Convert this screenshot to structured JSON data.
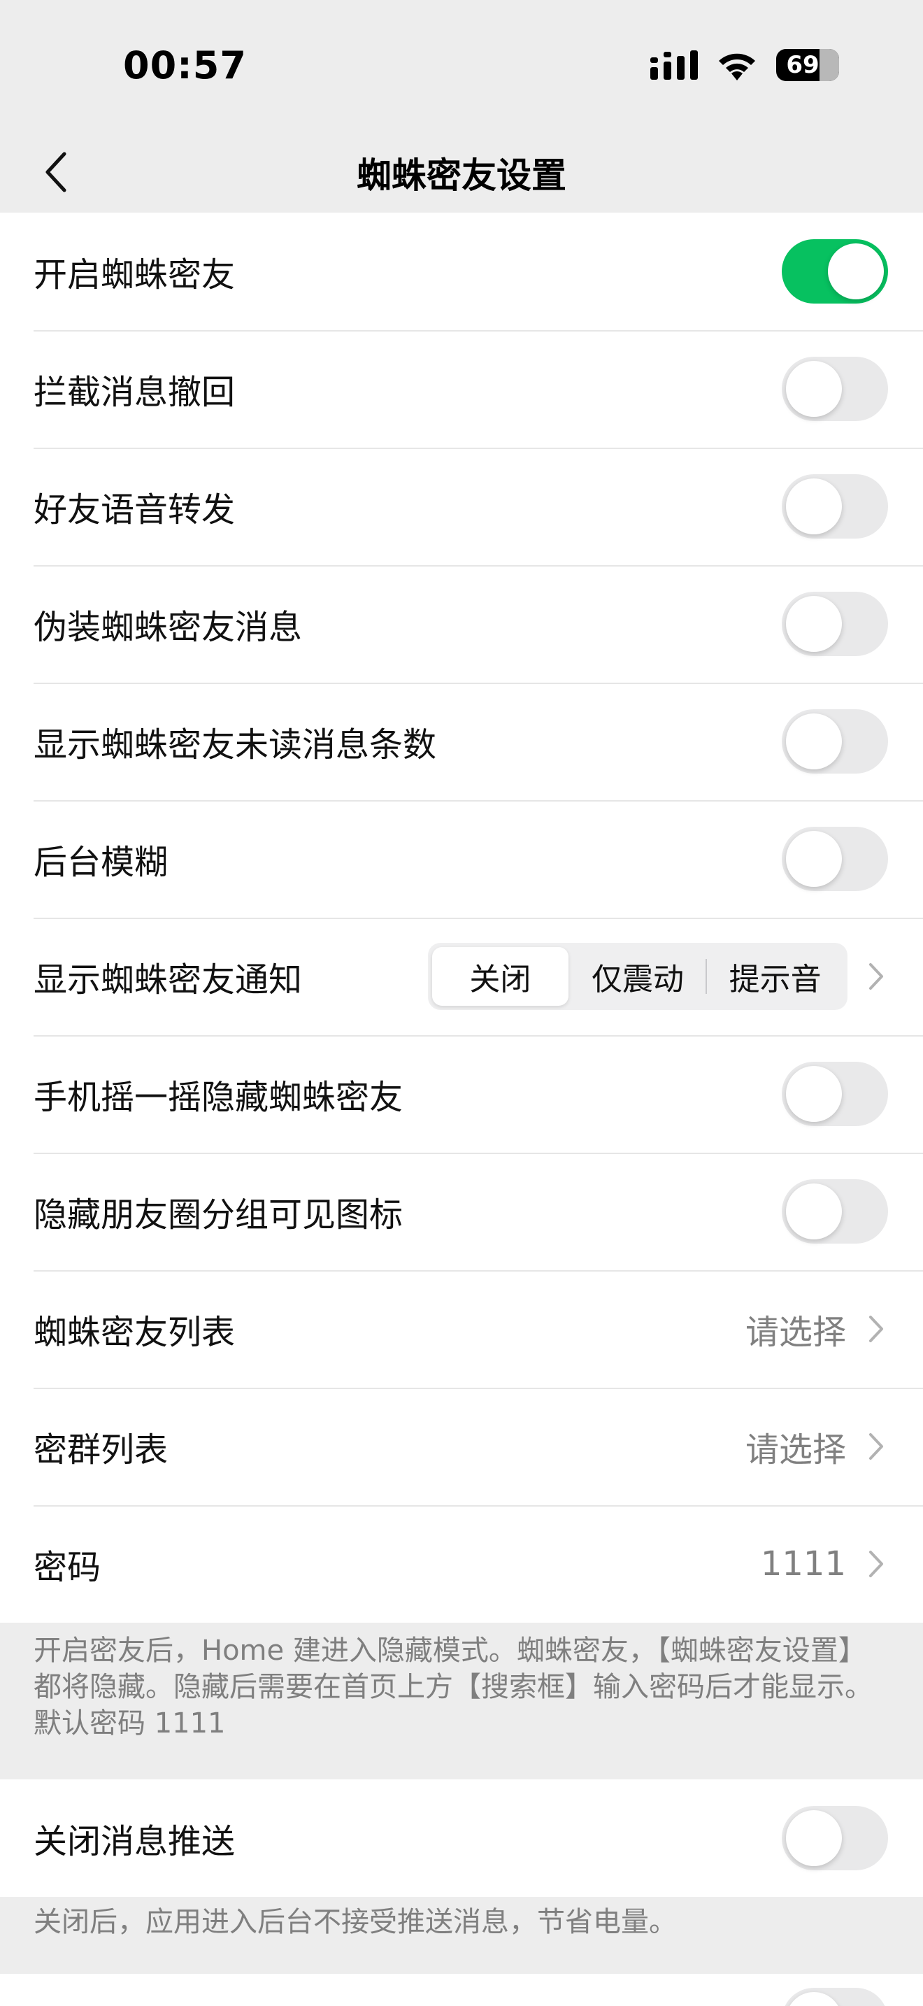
{
  "status_bar": {
    "time": "00:57",
    "battery": "69",
    "icons": [
      "signal-icon",
      "wifi-icon",
      "battery-icon"
    ]
  },
  "nav": {
    "title": "蜘蛛密友设置",
    "back_icon": "chevron-left-icon"
  },
  "section1": {
    "rows": [
      {
        "label": "开启蜘蛛密友",
        "toggle": true
      },
      {
        "label": "拦截消息撤回",
        "toggle": false
      },
      {
        "label": "好友语音转发",
        "toggle": false
      },
      {
        "label": "伪装蜘蛛密友消息",
        "toggle": false
      },
      {
        "label": "显示蜘蛛密友未读消息条数",
        "toggle": false
      },
      {
        "label": "后台模糊",
        "toggle": false
      },
      {
        "label": "显示蜘蛛密友通知",
        "segments": [
          "关闭",
          "仅震动",
          "提示音"
        ],
        "selected": "关闭"
      },
      {
        "label": "手机摇一摇隐藏蜘蛛密友",
        "toggle": false
      },
      {
        "label": "隐藏朋友圈分组可见图标",
        "toggle": false
      },
      {
        "label": "蜘蛛密友列表",
        "value": "请选择"
      },
      {
        "label": "密群列表",
        "value": "请选择"
      },
      {
        "label": "密码",
        "value": "1111"
      }
    ],
    "footnote": "开启密友后，Home 建进入隐藏模式。蜘蛛密友，【蜘蛛密友设置】都将隐藏。隐藏后需要在首页上方【搜索框】输入密码后才能显示。默认密码 1111"
  },
  "section2": {
    "rows": [
      {
        "label": "关闭消息推送",
        "toggle": false
      }
    ],
    "footnote": "关闭后，应用进入后台不接受推送消息，节省电量。"
  },
  "colors": {
    "accent_green": "#07c160",
    "background": "#ededed",
    "toggle_off": "#e9e9ea"
  }
}
